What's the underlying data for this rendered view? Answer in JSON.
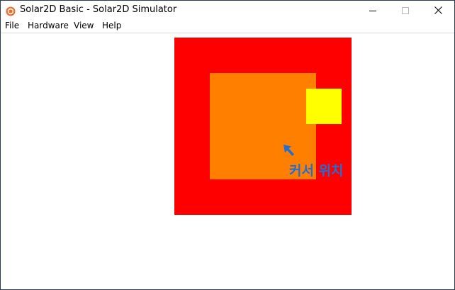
{
  "window": {
    "title": "Solar2D Basic - Solar2D Simulator",
    "controls": {
      "minimize": "minimize-icon",
      "maximize": "maximize-icon",
      "close": "close-icon"
    }
  },
  "menu": {
    "items": [
      {
        "label": "File"
      },
      {
        "label": "Hardware"
      },
      {
        "label": "View"
      },
      {
        "label": "Help"
      }
    ]
  },
  "canvas": {
    "background": "#ffffff",
    "shapes": {
      "outer_color": "#ff0000",
      "middle_color": "#ff8000",
      "inner_color": "#ffff00"
    },
    "cursor": {
      "icon": "cursor-arrow-icon",
      "color": "#1f6fd6",
      "label": "커서 위치"
    }
  }
}
